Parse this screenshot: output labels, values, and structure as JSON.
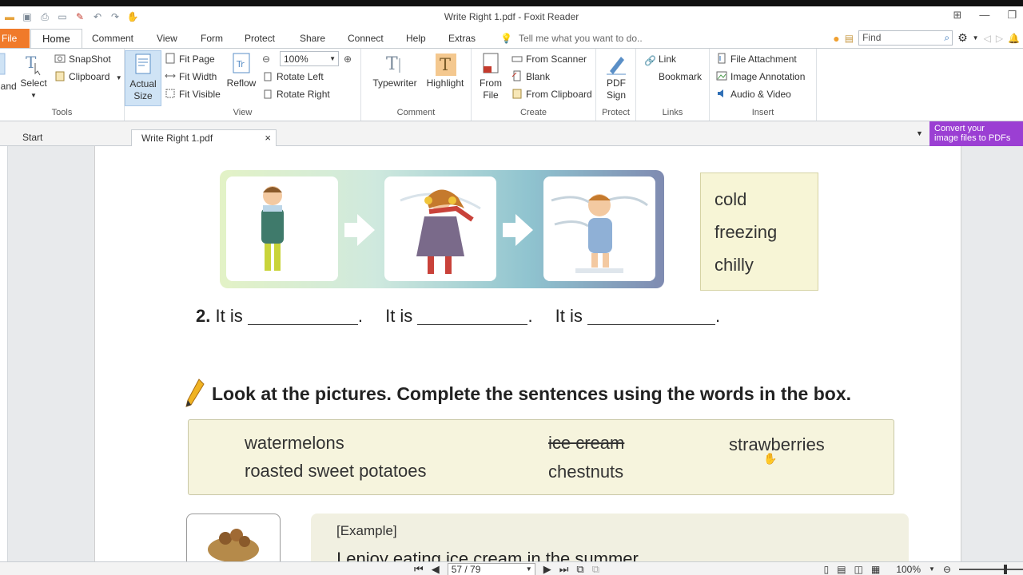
{
  "app": {
    "title": "Write Right 1.pdf - Foxit Reader"
  },
  "menu": {
    "file": "File",
    "tabs": [
      "Home",
      "Comment",
      "View",
      "Form",
      "Protect",
      "Share",
      "Connect",
      "Help",
      "Extras"
    ],
    "tell_me": "Tell me what you want to do..",
    "find_placeholder": "Find"
  },
  "ribbon": {
    "tools": {
      "name": "Tools",
      "hand": "Hand",
      "select": "Select",
      "snapshot": "SnapShot",
      "clipboard": "Clipboard"
    },
    "view": {
      "name": "View",
      "actual_size_line1": "Actual",
      "actual_size_line2": "Size",
      "fit_page": "Fit Page",
      "fit_width": "Fit Width",
      "fit_visible": "Fit Visible",
      "reflow": "Reflow",
      "zoom_value": "100%",
      "rotate_left": "Rotate Left",
      "rotate_right": "Rotate Right"
    },
    "comment": {
      "name": "Comment",
      "typewriter": "Typewriter",
      "highlight": "Highlight"
    },
    "create": {
      "name": "Create",
      "from_file_line1": "From",
      "from_file_line2": "File",
      "from_scanner": "From Scanner",
      "blank": "Blank",
      "from_clipboard": "From Clipboard"
    },
    "protect": {
      "name": "Protect",
      "pdf_sign_line1": "PDF",
      "pdf_sign_line2": "Sign"
    },
    "links": {
      "name": "Links",
      "link": "Link",
      "bookmark": "Bookmark"
    },
    "insert": {
      "name": "Insert",
      "file_attachment": "File Attachment",
      "image_annotation": "Image Annotation",
      "audio_video": "Audio & Video"
    }
  },
  "doc_tabs": {
    "start": "Start",
    "current": "Write Right 1.pdf",
    "promo_line1": "Convert your",
    "promo_line2": "image files to PDFs"
  },
  "document": {
    "word_box_1": [
      "cold",
      "freezing",
      "chilly"
    ],
    "q2_number": "2.",
    "q2_it_is": "It is",
    "instruction": "Look at the pictures. Complete the sentences using the words in the box.",
    "word_box_2": {
      "row1": [
        "watermelons",
        "ice cream",
        "strawberries"
      ],
      "row2": [
        "roasted sweet potatoes",
        "chestnuts"
      ]
    },
    "example_label": "[Example]",
    "example_sentence": "I enjoy eating ice cream in the summer."
  },
  "status": {
    "page_display": "57 / 79",
    "zoom": "100%"
  },
  "colors": {
    "accent": "#f07a2a",
    "promo": "#9b3fd3",
    "brand_blue": "#2f6fb6"
  }
}
